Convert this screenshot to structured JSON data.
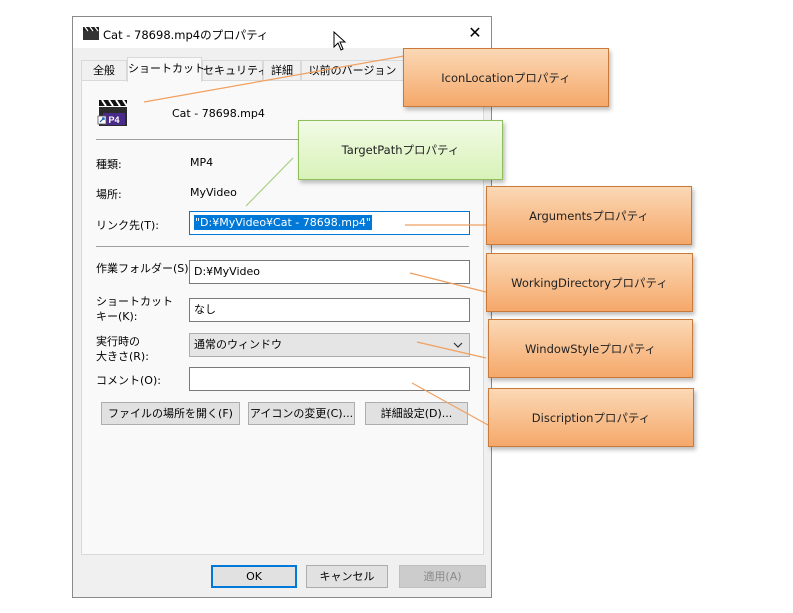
{
  "window": {
    "title": "Cat - 78698.mp4のプロパティ",
    "close_glyph": "✕"
  },
  "tabs": [
    {
      "label": "全般",
      "active": false
    },
    {
      "label": "ショートカット",
      "active": true
    },
    {
      "label": "セキュリティ",
      "active": false
    },
    {
      "label": "詳細",
      "active": false
    },
    {
      "label": "以前のバージョン",
      "active": false
    }
  ],
  "file": {
    "icon": "mp4-shortcut-icon",
    "icon_badge": "P4",
    "name": "Cat - 78698.mp4"
  },
  "fields": {
    "type_label": "種類:",
    "type_value": "MP4",
    "location_label": "場所:",
    "location_value": "MyVideo",
    "target_label": "リンク先(T):",
    "target_value": "\"D:¥MyVideo¥Cat - 78698.mp4\"",
    "workdir_label": "作業フォルダー(S):",
    "workdir_value": "D:¥MyVideo",
    "shortcutkey_label_1": "ショートカット",
    "shortcutkey_label_2": "キー(K):",
    "shortcutkey_value": "なし",
    "run_label_1": "実行時の",
    "run_label_2": "大きさ(R):",
    "run_value": "通常のウィンドウ",
    "comment_label": "コメント(O):",
    "comment_value": ""
  },
  "buttons": {
    "open_location": "ファイルの場所を開く(F)",
    "change_icon": "アイコンの変更(C)...",
    "advanced": "詳細設定(D)...",
    "ok": "OK",
    "cancel": "キャンセル",
    "apply": "適用(A)"
  },
  "callouts": {
    "icon_location": "IconLocationプロパティ",
    "target_path": "TargetPathプロパティ",
    "arguments": "Argumentsプロパティ",
    "working_directory": "WorkingDirectoryプロパティ",
    "window_style": "WindowStyleプロパティ",
    "description": "Discriptionプロパティ"
  },
  "colors": {
    "callout_orange": "#f5a86a",
    "callout_green": "#d8f2b8",
    "selection_blue": "#0078d7",
    "focus_border": "#0078d7"
  }
}
